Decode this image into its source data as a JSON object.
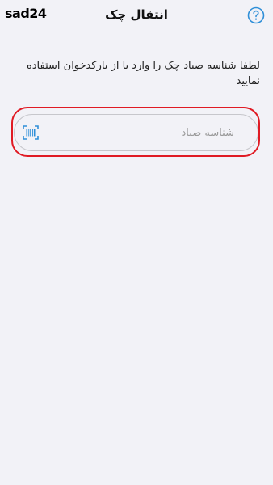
{
  "header": {
    "watermark": "sad24",
    "title": "انتقال چک"
  },
  "instruction": "لطفا شناسه صیاد چک را وارد یا از بارکدخوان استفاده نمایید",
  "sayad_input": {
    "placeholder": "شناسه صیاد",
    "value": ""
  },
  "icons": {
    "help": "help-icon",
    "barcode": "barcode-scanner-icon"
  },
  "colors": {
    "accent": "#2f8fd8",
    "highlight": "#e01b24",
    "background": "#f2f2f7"
  }
}
